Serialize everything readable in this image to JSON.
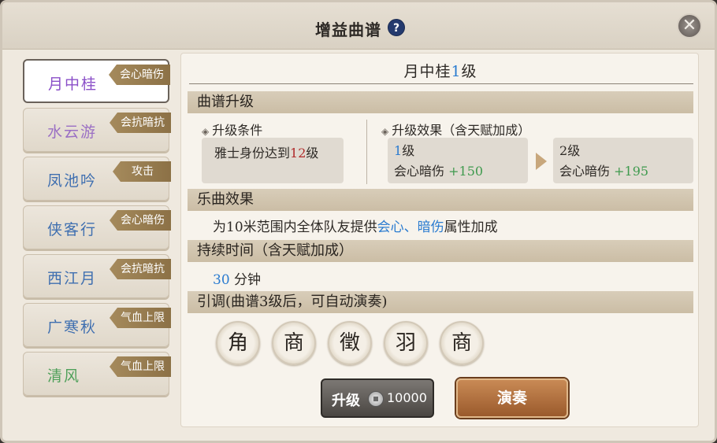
{
  "header": {
    "title": "增益曲谱"
  },
  "sidebar": {
    "items": [
      {
        "name": "月中桂",
        "tag": "会心暗伤",
        "color": "#8a4fc8",
        "active": true
      },
      {
        "name": "水云游",
        "tag": "会抗暗抗",
        "color": "#9a6fc4"
      },
      {
        "name": "凤池吟",
        "tag": "攻击",
        "color": "#3f6fb0"
      },
      {
        "name": "侠客行",
        "tag": "会心暗伤",
        "color": "#3f6fb0"
      },
      {
        "name": "西江月",
        "tag": "会抗暗抗",
        "color": "#3f6fb0"
      },
      {
        "name": "广寒秋",
        "tag": "气血上限",
        "color": "#3f6fb0"
      },
      {
        "name": "清风",
        "tag": "气血上限",
        "color": "#4fa05a"
      }
    ]
  },
  "detail": {
    "name": "月中桂",
    "level": "1",
    "level_suffix": "级",
    "upgrade_section": "曲谱升级",
    "condition_label": "升级条件",
    "condition_text": "雅士身份达到",
    "condition_level": "12",
    "condition_suffix": "级",
    "effect_label": "升级效果（含天赋加成）",
    "current": {
      "level_num": "1",
      "level_suffix": "级",
      "stat": "会心暗伤",
      "value": "+150"
    },
    "next": {
      "level_num": "2",
      "level_suffix": "级",
      "stat": "会心暗伤",
      "value": "+195"
    },
    "music_section": "乐曲效果",
    "music_pre": "为10米范围内全体队友提供",
    "music_highlight": "会心、暗伤",
    "music_post": "属性加成",
    "duration_section": "持续时间（含天赋加成）",
    "duration_value": "30",
    "duration_unit": "分钟",
    "prelude_section": "引调(曲谱3级后，可自动演奏)",
    "notes": [
      "角",
      "商",
      "徵",
      "羽",
      "商"
    ]
  },
  "buttons": {
    "upgrade_label": "升级",
    "upgrade_cost": "10000",
    "play_label": "演奏"
  }
}
